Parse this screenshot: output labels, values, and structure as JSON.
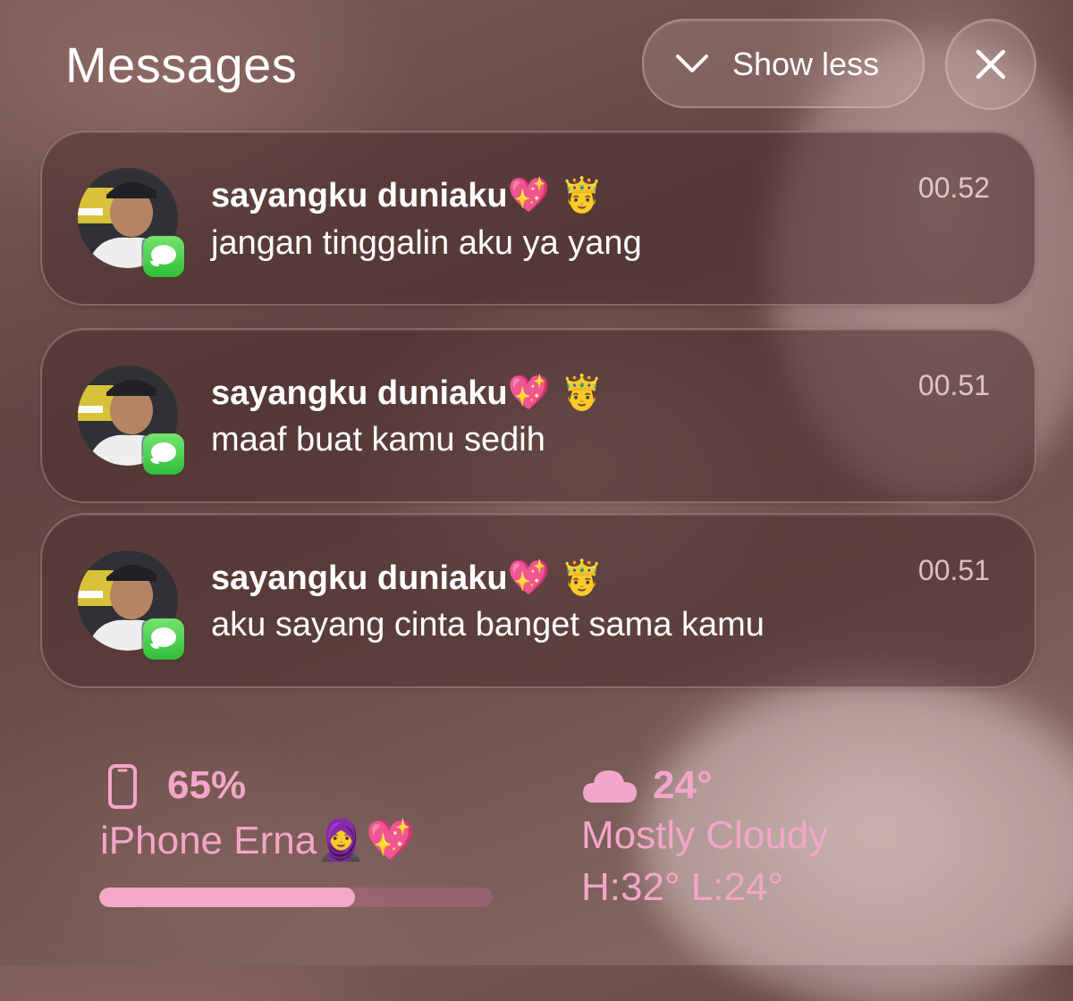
{
  "header": {
    "title": "Messages",
    "show_less_label": "Show less"
  },
  "notifications": [
    {
      "sender": "sayangku duniaku",
      "sender_emoji": "💖 🤴",
      "message": "jangan tinggalin aku ya yang",
      "time": "00.52",
      "app_icon": "messages-app-icon"
    },
    {
      "sender": "sayangku duniaku",
      "sender_emoji": "💖 🤴",
      "message": "maaf buat kamu sedih",
      "time": "00.51",
      "app_icon": "messages-app-icon"
    },
    {
      "sender": "sayangku duniaku",
      "sender_emoji": "💖 🤴",
      "message": "aku sayang cinta banget sama kamu",
      "time": "00.51",
      "app_icon": "messages-app-icon"
    }
  ],
  "battery_widget": {
    "percent_text": "65%",
    "level": 0.65,
    "device_name": "iPhone Erna",
    "device_emoji": "🧕💖",
    "icon": "phone-outline-icon"
  },
  "weather_widget": {
    "temperature": "24°",
    "condition": "Mostly Cloudy",
    "high_low": "H:32° L:24°",
    "icon": "cloud-icon"
  },
  "colors": {
    "widget_pink": "#f3a6c9",
    "badge_green": "#2fbf3a",
    "text_white": "#ffffff"
  }
}
